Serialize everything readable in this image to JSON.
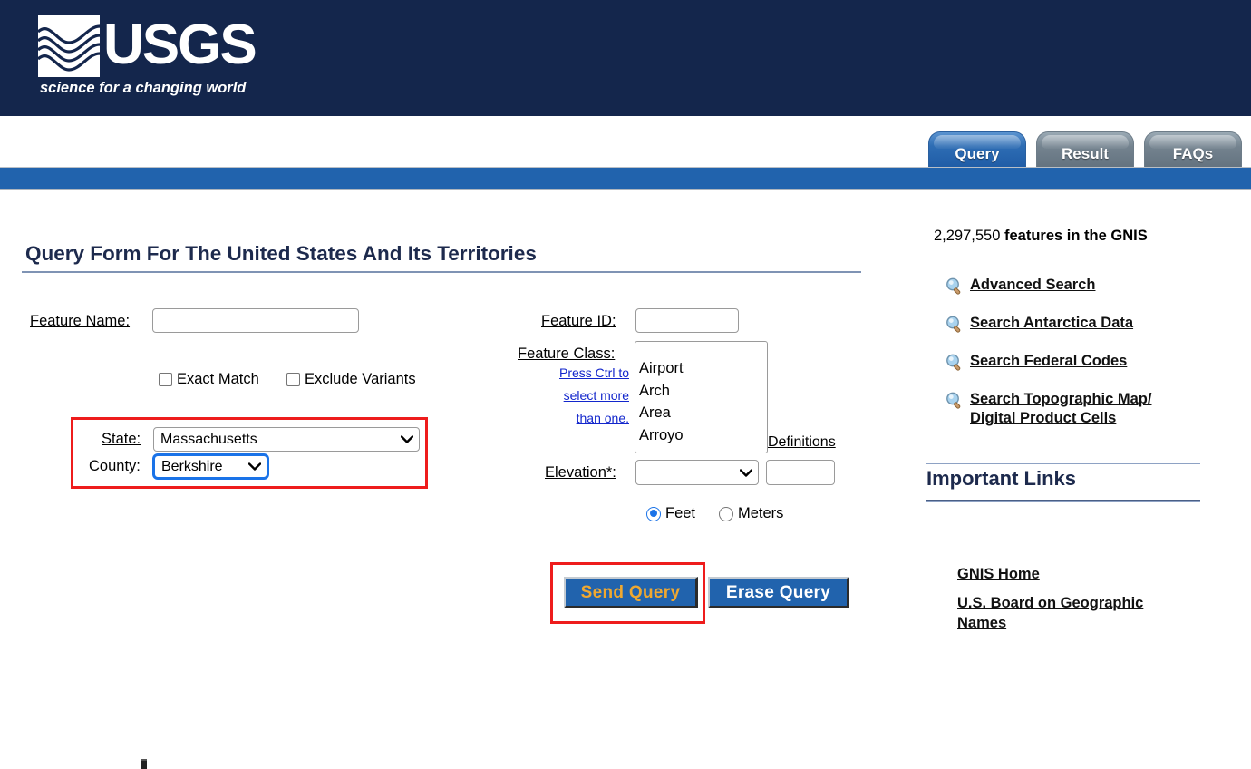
{
  "header": {
    "logo_wordmark": "USGS",
    "tagline": "science for a changing world"
  },
  "tabs": [
    {
      "label": "Query",
      "active": true
    },
    {
      "label": "Result",
      "active": false
    },
    {
      "label": "FAQs",
      "active": false
    }
  ],
  "form": {
    "title": "Query Form For The United States And Its Territories",
    "feature_name_label": "Feature Name:",
    "feature_name_value": "",
    "feature_id_label": "Feature ID:",
    "feature_id_value": "",
    "exact_match_label": "Exact Match",
    "exact_match_checked": false,
    "exclude_variants_label": "Exclude Variants",
    "exclude_variants_checked": false,
    "state_label": "State:",
    "state_value": "Massachusetts",
    "county_label": "County:",
    "county_value": "Berkshire",
    "feature_class_label": "Feature Class:",
    "feature_class_hint_line1": "Press Ctrl to",
    "feature_class_hint_line2": "select more",
    "feature_class_hint_line3": "than one.",
    "feature_class_options": [
      "Airport",
      "Arch",
      "Area",
      "Arroyo"
    ],
    "definitions_label": "Definitions",
    "elevation_label": "Elevation*:",
    "elevation_operator_value": "",
    "elevation_value": "",
    "unit_feet_label": "Feet",
    "unit_meters_label": "Meters",
    "unit_selected": "Feet",
    "send_button_label": "Send Query",
    "erase_button_label": "Erase Query"
  },
  "sidebar": {
    "features_count": "2,297,550",
    "features_count_suffix": "features in the GNIS",
    "search_links": [
      {
        "label": "Advanced Search"
      },
      {
        "label": "Search Antarctica Data"
      },
      {
        "label": "Search Federal Codes"
      },
      {
        "label": "Search Topographic Map/",
        "label2": "Digital Product Cells"
      }
    ],
    "important_links_title": "Important Links",
    "important_links": [
      {
        "label": "GNIS Home"
      },
      {
        "label": "U.S. Board on Geographic",
        "label2": "Names"
      }
    ]
  },
  "colors": {
    "header_navy": "#14264c",
    "bar_blue": "#2163ad",
    "title_navy": "#1d2a4d",
    "link_blue": "#1226cc",
    "annotation_red": "#ee1c1c",
    "send_text_gold": "#f0a830",
    "focus_blue": "#1a73e8"
  }
}
